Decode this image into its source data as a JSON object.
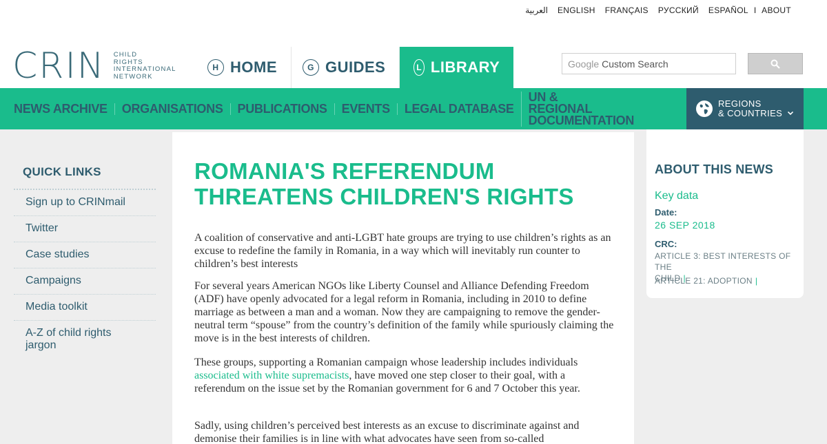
{
  "lang": {
    "items": [
      "العربية",
      "ENGLISH",
      "FRANÇAIS",
      "РУССКИЙ",
      "ESPAÑOL"
    ],
    "separator": "I",
    "about": "ABOUT"
  },
  "logo": {
    "main": "CRIN",
    "sub": [
      "CHILD",
      "RIGHTS",
      "INTERNATIONAL",
      "NETWORK"
    ]
  },
  "tabs": [
    {
      "key": "H",
      "label": "HOME"
    },
    {
      "key": "G",
      "label": "GUIDES"
    },
    {
      "key": "L",
      "label": "LIBRARY"
    }
  ],
  "search": {
    "google": "Google",
    "placeholder": "Custom Search"
  },
  "subnav": {
    "items": [
      "NEWS ARCHIVE",
      "ORGANISATIONS",
      "PUBLICATIONS",
      "EVENTS",
      "LEGAL DATABASE"
    ],
    "un_line1": "UN & REGIONAL",
    "un_line2": "DOCUMENTATION",
    "regions_line1": "REGIONS",
    "regions_line2": "& COUNTRIES"
  },
  "quicklinks": {
    "title": "QUICK LINKS",
    "items": [
      "Sign up to CRINmail",
      "Twitter",
      "Case studies",
      "Campaigns",
      "Media toolkit",
      "A-Z of child rights jargon"
    ]
  },
  "article": {
    "headline_1": "ROMANIA'S REFERENDUM",
    "headline_2": "THREATENS CHILDREN'S RIGHTS",
    "p1": "A coalition of conservative and anti-LGBT hate groups are trying to use children’s rights as an excuse to redefine the family in Romania, in a way which will inevitably run counter to children’s best interests",
    "p2": "For several years American NGOs like Liberty Counsel and Alliance Defending Freedom (ADF) have openly advocated for a legal reform in Romania, including in 2010 to define marriage as between a man and a woman. Now they are campaigning to remove the gender-neutral term “spouse” from the country’s definition of the family while spuriously claiming the move is in the best interests of children.",
    "p3_before": "These groups, supporting a Romanian campaign whose leadership includes individuals ",
    "p3_link": "associated with white supremacists",
    "p3_after": ", have moved one step closer to their goal, with a referendum on the issue set by the Romanian government for 6 and 7 October this year.",
    "p4": "Sadly, using children’s perceived best interests as an excuse to discriminate against and demonise their families is in line with what advocates have seen from so-called"
  },
  "about": {
    "title": "ABOUT THIS NEWS",
    "key_data": "Key data",
    "date_label": "Date:",
    "date_value": "26 SEP 2018",
    "crc_label": "CRC:",
    "crc_1a": "ARTICLE 3: BEST INTERESTS OF THE",
    "crc_1b": "CHILD",
    "crc_2": "ARTICLE 21: ADOPTION",
    "bar": "|"
  },
  "colors": {
    "accent": "#1abc8c",
    "brand_dark": "#2e5c6e",
    "background": "#eeeeee"
  }
}
